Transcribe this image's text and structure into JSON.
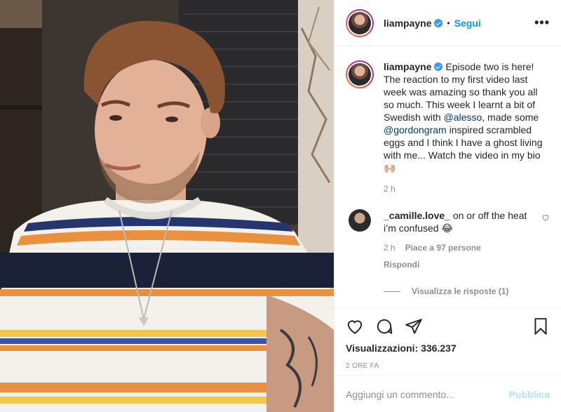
{
  "header": {
    "username": "liampayne",
    "separator": "•",
    "follow_label": "Segui",
    "more_label": "•••"
  },
  "caption": {
    "username": "liampayne",
    "text_1": "Episode two is here! The reaction to my first video last week was amazing so thank you all so much. This week I learnt a bit of Swedish with ",
    "mention_1": "@alesso",
    "text_2": ", made some ",
    "mention_2": "@gordongram",
    "text_3": " inspired scrambled eggs and I think I have a ghost living with me... Watch the video in my bio 🙌🏼",
    "time": "2 h"
  },
  "comment": {
    "username": "_camille.love_",
    "text": "on or off the heat i’m confused 😂",
    "time": "2 h",
    "likes": "Piace a 97 persone",
    "reply_label": "Rispondi",
    "view_replies": "Visualizza le risposte (1)"
  },
  "actions": {
    "views_label": "Visualizzazioni:",
    "views_count": "336.237",
    "posted_time": "2 ORE FA"
  },
  "add_comment": {
    "placeholder": "Aggiungi un commento...",
    "publish_label": "Pubblica"
  },
  "icons": [
    "heart-icon",
    "comment-icon",
    "share-icon",
    "bookmark-icon",
    "verified-icon",
    "more-icon"
  ]
}
